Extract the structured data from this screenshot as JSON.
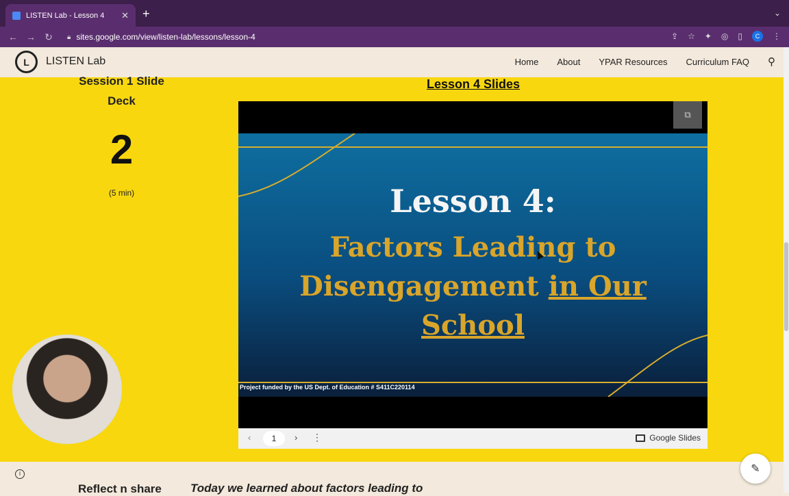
{
  "browser": {
    "tab_title": "LISTEN Lab - Lesson 4",
    "url": "sites.google.com/view/listen-lab/lessons/lesson-4",
    "profile_initial": "C"
  },
  "site": {
    "name": "LISTEN Lab",
    "logo_text": "L",
    "nav": [
      "Home",
      "About",
      "YPAR Resources",
      "Curriculum FAQ"
    ]
  },
  "session": {
    "deck_title": "Session 1 Slide Deck",
    "number": "2",
    "duration": "(5 min)"
  },
  "slides_embed": {
    "link_label": "Lesson 4 Slides",
    "heading": "Lesson 4:",
    "subtitle_line1": "Factors Leading to",
    "subtitle_line2a": "Disengagement ",
    "subtitle_line2b": "in Our",
    "subtitle_line3": "School",
    "footer": "Project funded by the US Dept. of Education # S411C220114",
    "current_page": "1",
    "brand": "Google Slides"
  },
  "below": {
    "reflect_heading": "Reflect n share",
    "today_text": "Today we learned about factors leading to"
  },
  "colors": {
    "page_bg": "#f8d70f",
    "slide_gold": "#d9a52a",
    "chrome_purple": "#5a2e6e"
  }
}
